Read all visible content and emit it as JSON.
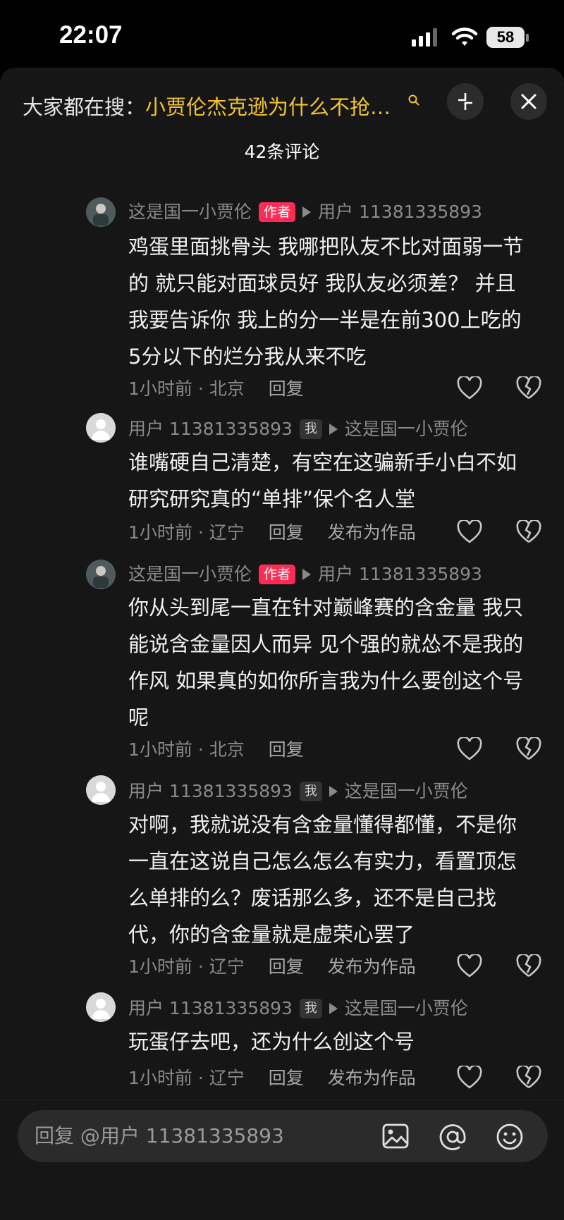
{
  "status": {
    "time": "22:07",
    "battery": "58"
  },
  "header": {
    "search_prefix": "大家都在搜：",
    "search_term": "小贾伦杰克逊为什么不抢…",
    "comment_count": "42条评论"
  },
  "comments": [
    {
      "author": "这是国一小贾伦",
      "badge": "作者",
      "reply_to": "用户 11381335893",
      "lines": [
        "鸡蛋里面挑骨头 我哪把队友不比对面弱一节",
        "的 就只能对面球员好 我队友必须差？ 并且",
        "我要告诉你 我上的分一半是在前300上吃的",
        "5分以下的烂分我从来不吃"
      ],
      "time_loc": "1小时前 · 北京",
      "reply_label": "回复",
      "publish_label": ""
    },
    {
      "author": "用户 11381335893",
      "badge": "我",
      "reply_to": "这是国一小贾伦",
      "lines": [
        "谁嘴硬自己清楚，有空在这骗新手小白不如",
        "研究研究真的“单排”保个名人堂"
      ],
      "time_loc": "1小时前 · 辽宁",
      "reply_label": "回复",
      "publish_label": "发布为作品"
    },
    {
      "author": "这是国一小贾伦",
      "badge": "作者",
      "reply_to": "用户 11381335893",
      "lines": [
        "你从头到尾一直在针对巅峰赛的含金量 我只",
        "能说含金量因人而异 见个强的就怂不是我的",
        "作风 如果真的如你所言我为什么要创这个号",
        "呢"
      ],
      "time_loc": "1小时前 · 北京",
      "reply_label": "回复",
      "publish_label": ""
    },
    {
      "author": "用户 11381335893",
      "badge": "我",
      "reply_to": "这是国一小贾伦",
      "lines": [
        "对啊，我就说没有含金量懂得都懂，不是你",
        "一直在这说自己怎么怎么有实力，看置顶怎",
        "么单排的么？废话那么多，还不是自己找",
        "代，你的含金量就是虚荣心罢了"
      ],
      "time_loc": "1小时前 · 辽宁",
      "reply_label": "回复",
      "publish_label": "发布为作品"
    },
    {
      "author": "用户 11381335893",
      "badge": "我",
      "reply_to": "这是国一小贾伦",
      "lines": [
        "玩蛋仔去吧，还为什么创这个号"
      ],
      "time_loc": "1小时前 · 辽宁",
      "reply_label": "回复",
      "publish_label": "发布为作品"
    }
  ],
  "input": {
    "placeholder": "回复 @用户 11381335893"
  },
  "icons": [
    "search-icon",
    "collapse-icon",
    "close-icon",
    "avatar-author",
    "avatar-default",
    "like-icon",
    "dislike-icon",
    "image-icon",
    "at-icon",
    "emoji-icon"
  ],
  "colors": {
    "accent_search": "#f4c430",
    "author_badge": "#fe2c55",
    "sheet_bg": "#161616"
  }
}
